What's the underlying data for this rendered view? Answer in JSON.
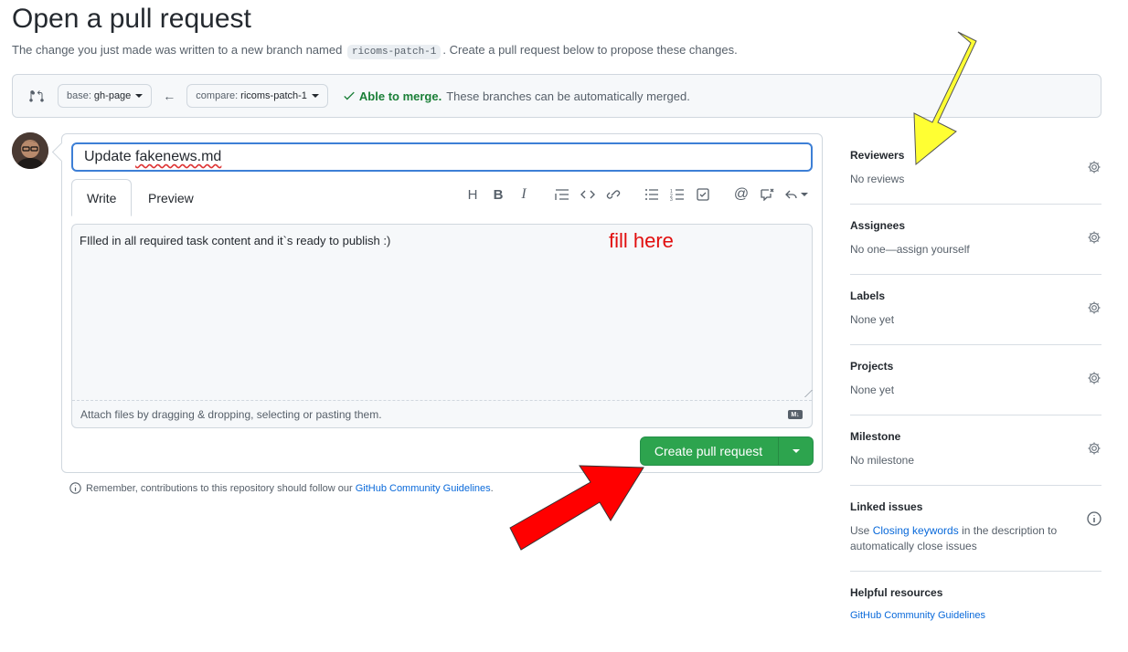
{
  "header": {
    "title": "Open a pull request",
    "subtitle_before": "The change you just made was written to a new branch named",
    "branch_code": "ricoms-patch-1",
    "subtitle_after": ". Create a pull request below to propose these changes."
  },
  "compare": {
    "base_prefix": "base:",
    "base_branch": "gh-page",
    "compare_prefix": "compare:",
    "compare_branch": "ricoms-patch-1",
    "merge_status": "Able to merge.",
    "merge_message": "These branches can be automatically merged."
  },
  "form": {
    "title_word1": "Update",
    "title_word2": "fakenews.md",
    "tab_write": "Write",
    "tab_preview": "Preview",
    "body_text": "FIlled in all required task content and it`s ready to publish :)",
    "attach_hint": "Attach files by dragging & dropping, selecting or pasting them.",
    "markdown_badge": "M↓"
  },
  "toolbar": [
    "heading-icon",
    "bold-icon",
    "italic-icon",
    "quote-icon",
    "code-icon",
    "link-icon",
    "unordered-list-icon",
    "ordered-list-icon",
    "task-list-icon",
    "mention-icon",
    "reference-icon",
    "reply-icon"
  ],
  "annotations": {
    "fill_here": "fill here",
    "colors": {
      "yellow_arrow": "#ffff33",
      "red_arrow": "#ff0000"
    }
  },
  "create_button": {
    "label": "Create pull request"
  },
  "remember": {
    "text": "Remember, contributions to this repository should follow our",
    "link": "GitHub Community Guidelines",
    "end": "."
  },
  "sidebar": {
    "reviewers": {
      "title": "Reviewers",
      "value": "No reviews"
    },
    "assignees": {
      "title": "Assignees",
      "value": "No one—assign yourself"
    },
    "labels": {
      "title": "Labels",
      "value": "None yet"
    },
    "projects": {
      "title": "Projects",
      "value": "None yet"
    },
    "milestone": {
      "title": "Milestone",
      "value": "No milestone"
    },
    "linked_issues": {
      "title": "Linked issues",
      "text_before": "Use",
      "link": "Closing keywords",
      "text_after": "in the description to automatically close issues"
    },
    "helpful": {
      "title": "Helpful resources",
      "link": "GitHub Community Guidelines"
    }
  },
  "colors": {
    "accent": "#2da44e",
    "link": "#0969da",
    "merge_ok": "#1a7f37"
  }
}
